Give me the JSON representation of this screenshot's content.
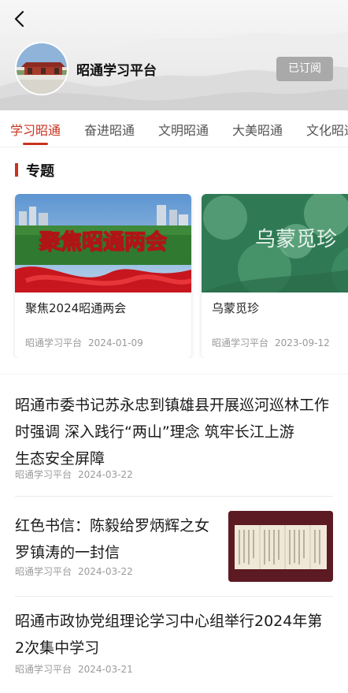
{
  "header": {
    "platform_name": "昭通学习平台",
    "subscribe_label": "已订阅"
  },
  "tabs": [
    {
      "label": "学习昭通",
      "active": true
    },
    {
      "label": "奋进昭通",
      "active": false
    },
    {
      "label": "文明昭通",
      "active": false
    },
    {
      "label": "大美昭通",
      "active": false
    },
    {
      "label": "文化昭通",
      "active": false
    }
  ],
  "section": {
    "title": "专题",
    "cards": [
      {
        "image_text": "聚焦昭通两会",
        "title": "聚焦2024昭通两会",
        "source": "昭通学习平台",
        "date": "2024-01-09"
      },
      {
        "image_text": "乌蒙觅珍",
        "title": "乌蒙觅珍",
        "source": "昭通学习平台",
        "date": "2023-09-12"
      }
    ]
  },
  "articles": [
    {
      "title_lines": [
        "昭通市委书记苏永忠到镇雄县开展巡河巡林工作",
        "时强调 深入践行“两山”理念 筑牢长江上游",
        "生态安全屏障"
      ],
      "source": "昭通学习平台",
      "date": "2024-03-22"
    },
    {
      "title_lines": [
        "红色书信：陈毅给罗炳辉之女",
        "罗镇涛的一封信"
      ],
      "source": "昭通学习平台",
      "date": "2024-03-22"
    },
    {
      "title_lines": [
        "昭通市政协党组理论学习中心组举行2024年第",
        "2次集中学习"
      ],
      "source": "昭通学习平台",
      "date": "2024-03-21"
    }
  ],
  "colors": {
    "accent": "#c8321f",
    "subscribed_bg": "#a9a9a9"
  }
}
